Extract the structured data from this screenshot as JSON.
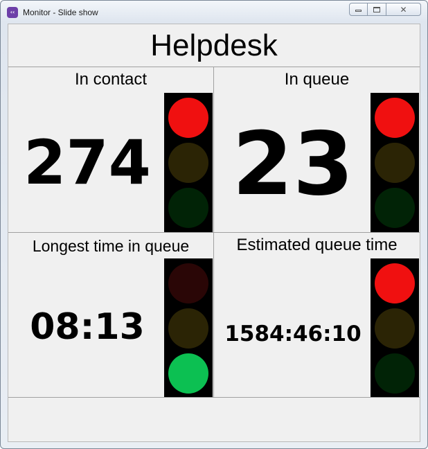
{
  "window": {
    "title": "Monitor - Slide show",
    "icon": "monitor-app-icon",
    "buttons": [
      "minimize",
      "maximize",
      "close"
    ]
  },
  "page": {
    "title": "Helpdesk"
  },
  "panels": [
    {
      "label": "In contact",
      "value": "274",
      "lights": {
        "red": "on",
        "yellow": "off",
        "green": "off"
      }
    },
    {
      "label": "In queue",
      "value": "23",
      "lights": {
        "red": "on",
        "yellow": "off",
        "green": "off"
      }
    },
    {
      "label": "Longest time in queue",
      "value": "08:13",
      "lights": {
        "red": "off",
        "yellow": "off",
        "green": "on"
      }
    },
    {
      "label": "Estimated queue time",
      "value": "1584:46:10",
      "lights": {
        "red": "on",
        "yellow": "off",
        "green": "off"
      }
    }
  ],
  "colors": {
    "red_on": "#f01010",
    "red_off": "#2a0606",
    "yellow_off": "#2b2405",
    "green_on": "#0cc052",
    "green_off": "#012306",
    "light_housing": "#000000"
  }
}
